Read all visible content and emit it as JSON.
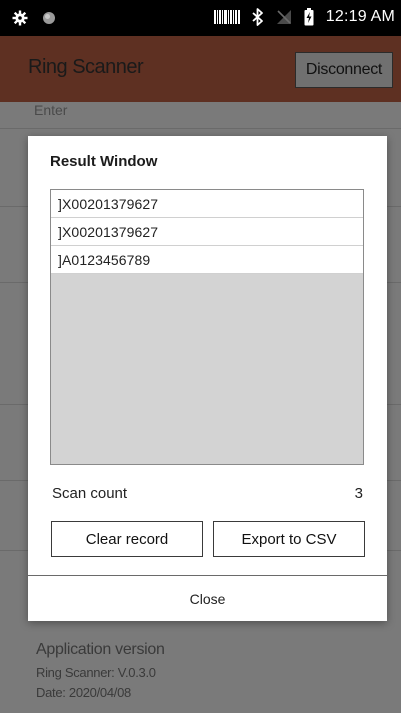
{
  "status_bar": {
    "left_icons": [
      "gear-icon",
      "circle-icon"
    ],
    "right_icons": [
      "barcode-icon",
      "bluetooth-icon",
      "no-signal-icon",
      "battery-charging-icon"
    ],
    "time": "12:19 AM"
  },
  "app_bar": {
    "title": "Ring Scanner",
    "disconnect_label": "Disconnect",
    "background_color": "#5e3022"
  },
  "background": {
    "enter_label": "Enter",
    "app_version_title": "Application version",
    "app_version_line": "Ring Scanner: V.0.3.0",
    "date_line": "Date: 2020/04/08"
  },
  "dialog": {
    "title": "Result Window",
    "results": [
      "]X00201379627",
      "]X00201379627",
      "]A0123456789"
    ],
    "scan_count_label": "Scan count",
    "scan_count_value": "3",
    "clear_label": "Clear record",
    "export_label": "Export to CSV",
    "close_label": "Close"
  }
}
